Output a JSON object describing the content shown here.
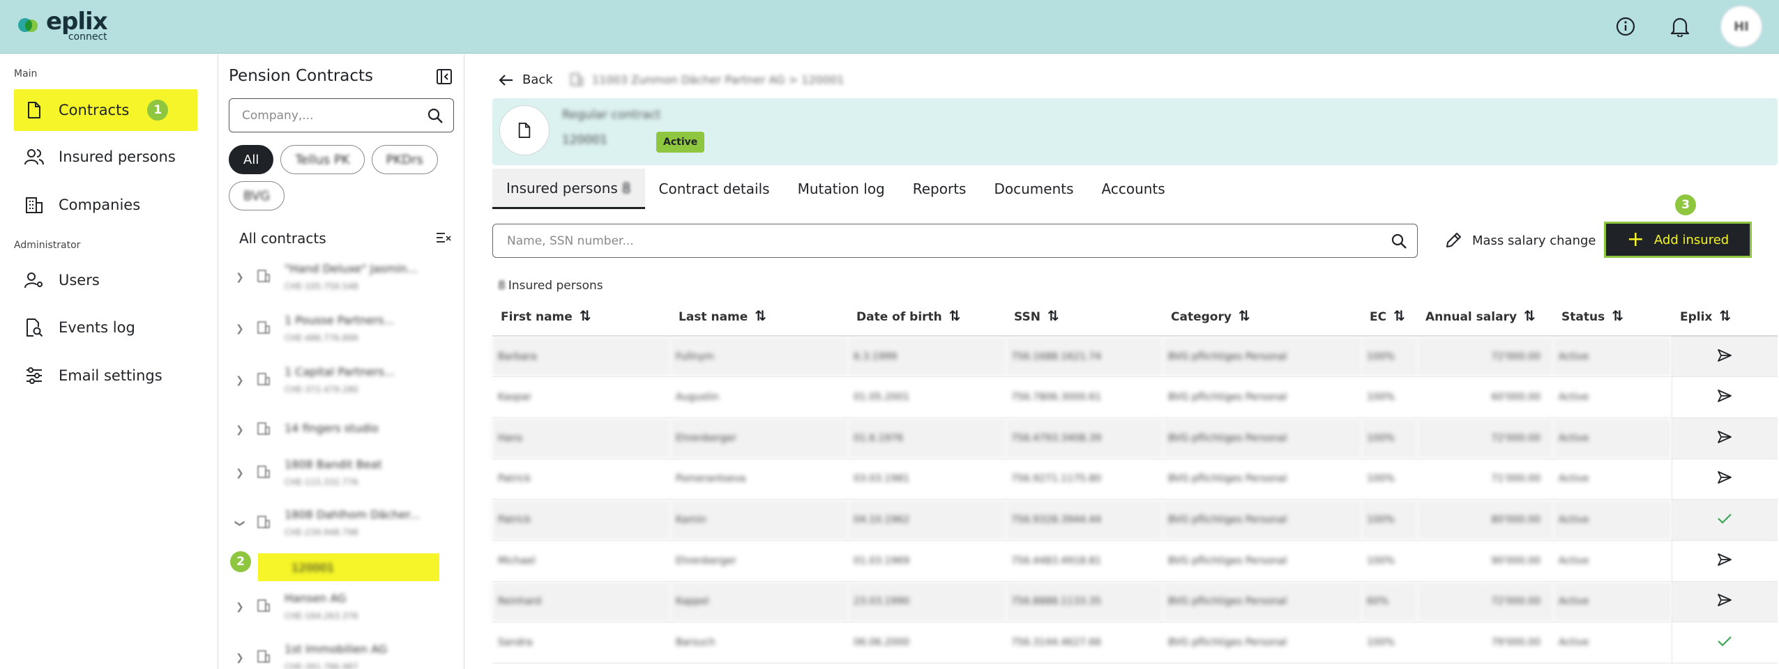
{
  "app": {
    "logo_word": "eplix",
    "logo_sub": "connect",
    "avatar_initials": "HI"
  },
  "sidebar": {
    "main_label": "Main",
    "admin_label": "Administrator",
    "items": [
      {
        "label": "Contracts",
        "step": "1"
      },
      {
        "label": "Insured persons"
      },
      {
        "label": "Companies"
      },
      {
        "label": "Users"
      },
      {
        "label": "Events log"
      },
      {
        "label": "Email settings"
      }
    ]
  },
  "contracts_panel": {
    "title": "Pension Contracts",
    "search_placeholder": "Company,...",
    "filters": [
      "All",
      "Tellus PK",
      "PKDrs",
      "BVG"
    ],
    "all_contracts_label": "All contracts",
    "tree": [
      {
        "name": "\"Hand Deluxe\" Jasmin...",
        "sub": "CHE-105.759.548"
      },
      {
        "name": "1 Pousse Partners...",
        "sub": "CHE-486.776.899"
      },
      {
        "name": "1 Capital Partners...",
        "sub": "CHE-372.479.280"
      },
      {
        "name": "14 fingers studio",
        "sub": ""
      },
      {
        "name": "1808 Bandit Beat",
        "sub": "CHE-115.332.776"
      },
      {
        "name": "1808 Dahlhom Dächer...",
        "sub": "CHE-239.948.798"
      },
      {
        "name": "Hansen AG",
        "sub": "CHE-164.263.376"
      },
      {
        "name": "1st Immobilien AG",
        "sub": "CHE-391.786.987"
      }
    ],
    "selected_sub": "120001",
    "selected_step": "2"
  },
  "detail": {
    "back_label": "Back",
    "breadcrumb": "11003 Zunmon Dächer Partner AG  >  120001",
    "contract_type": "Regular contract",
    "contract_number": "120001",
    "status_badge": "Active",
    "tabs": [
      {
        "label": "Insured persons",
        "count": "8"
      },
      {
        "label": "Contract details"
      },
      {
        "label": "Mutation log"
      },
      {
        "label": "Reports"
      },
      {
        "label": "Documents"
      },
      {
        "label": "Accounts"
      }
    ],
    "search_placeholder": "Name, SSN number...",
    "mass_salary_label": "Mass salary change",
    "add_insured_label": "Add insured",
    "add_step": "3",
    "insured_count": "8",
    "insured_label": "Insured persons"
  },
  "table": {
    "headers": [
      "First name",
      "Last name",
      "Date of birth",
      "SSN",
      "Category",
      "EC",
      "Annual salary",
      "Status",
      "Eplix"
    ],
    "rows": [
      [
        "Barbara",
        "Fullnym",
        "6.3.1999",
        "756.1688.1621.74",
        "BVG pflichtiges Personal",
        "100%",
        "72'000.00",
        "Active",
        "send"
      ],
      [
        "Kaspar",
        "Augustin",
        "01.05.2001",
        "756.7806.3000.61",
        "BVG pflichtiges Personal",
        "100%",
        "60'000.00",
        "Active",
        "send"
      ],
      [
        "Hans",
        "Ehrenberger",
        "01.6.1976",
        "756.4793.3408.39",
        "BVG pflichtiges Personal",
        "100%",
        "72'000.00",
        "Active",
        "send"
      ],
      [
        "Patrick",
        "Pomerantseva",
        "03.03.1981",
        "756.9271.1175.80",
        "BVG pflichtiges Personal",
        "100%",
        "71'000.00",
        "Active",
        "send"
      ],
      [
        "Patrick",
        "Kamin",
        "04.10.1962",
        "756.9328.3944.44",
        "BVG pflichtiges Personal",
        "100%",
        "80'000.00",
        "Active",
        "check"
      ],
      [
        "Michael",
        "Ehrenberger",
        "01.03.1969",
        "756.4483.4918.81",
        "BVG pflichtiges Personal",
        "100%",
        "90'000.00",
        "Active",
        "send"
      ],
      [
        "Reinhard",
        "Kappel",
        "23.03.1990",
        "756.8888.1133.35",
        "BVG pflichtiges Personal",
        "60%",
        "72'000.00",
        "Active",
        "send"
      ],
      [
        "Sandra",
        "Barsuch",
        "06.06.2000",
        "756.3144.4627.66",
        "BVG pflichtiges Personal",
        "100%",
        "79'000.00",
        "Active",
        "check"
      ]
    ]
  }
}
